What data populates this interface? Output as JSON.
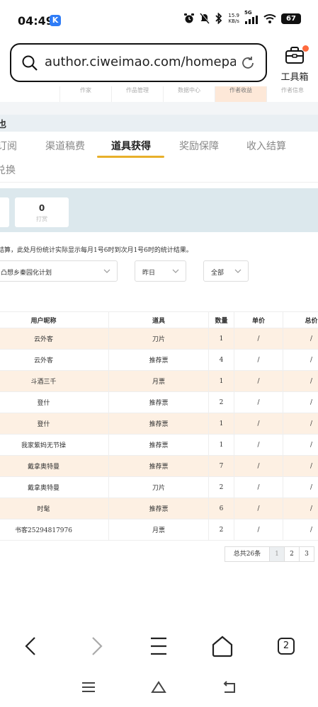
{
  "status": {
    "time": "04:49",
    "app_badge": "K",
    "speed_value": "15.9",
    "speed_unit": "KB/s",
    "network": "5G",
    "battery": "67"
  },
  "browser": {
    "url": "author.ciweimao.com/homepa···",
    "toolbox_label": "工具箱",
    "tab_count": "2"
  },
  "top_strip": [
    "作家",
    "作品管理",
    "数据中心",
    "作者收益",
    "作者信息"
  ],
  "section_title": "也",
  "nav": {
    "tabs": [
      {
        "label": "订阅"
      },
      {
        "label": "渠道稿费"
      },
      {
        "label": "道具获得"
      },
      {
        "label": "奖励保障"
      },
      {
        "label": "收入结算"
      }
    ],
    "second_row": "兑换"
  },
  "stats": {
    "value": "0",
    "label": "打赏"
  },
  "notice": "结算，此处月份统计实际显示每月1号6时到次月1号6时的统计结果。",
  "filters": {
    "book": "凸想乡秦园化计划",
    "date": "昨日",
    "type": "全部"
  },
  "table": {
    "headers": [
      "用户昵称",
      "道具",
      "数量",
      "单价",
      "总价"
    ],
    "rows": [
      [
        "云外客",
        "刀片",
        "1",
        "/",
        "/"
      ],
      [
        "云外客",
        "推荐票",
        "4",
        "/",
        "/"
      ],
      [
        "斗酒三千",
        "月票",
        "1",
        "/",
        "/"
      ],
      [
        "登什",
        "推荐票",
        "2",
        "/",
        "/"
      ],
      [
        "登什",
        "推荐票",
        "1",
        "/",
        "/"
      ],
      [
        "我家紫妈无节操",
        "推荐票",
        "1",
        "/",
        "/"
      ],
      [
        "戴拿奥特曼",
        "推荐票",
        "7",
        "/",
        "/"
      ],
      [
        "戴拿奥特曼",
        "刀片",
        "2",
        "/",
        "/"
      ],
      [
        "时髦",
        "推荐票",
        "6",
        "/",
        "/"
      ],
      [
        "书客25294817976",
        "月票",
        "2",
        "/",
        "/"
      ]
    ]
  },
  "pagination": {
    "total": "总共26条",
    "pages": [
      "1",
      "2",
      "3"
    ],
    "current": "1"
  },
  "colors": {
    "accent_underline": "#e8b02a",
    "row_highlight": "#fdf0e3",
    "stats_band": "#dce8ed",
    "notification_dot": "#ff6a3d"
  }
}
